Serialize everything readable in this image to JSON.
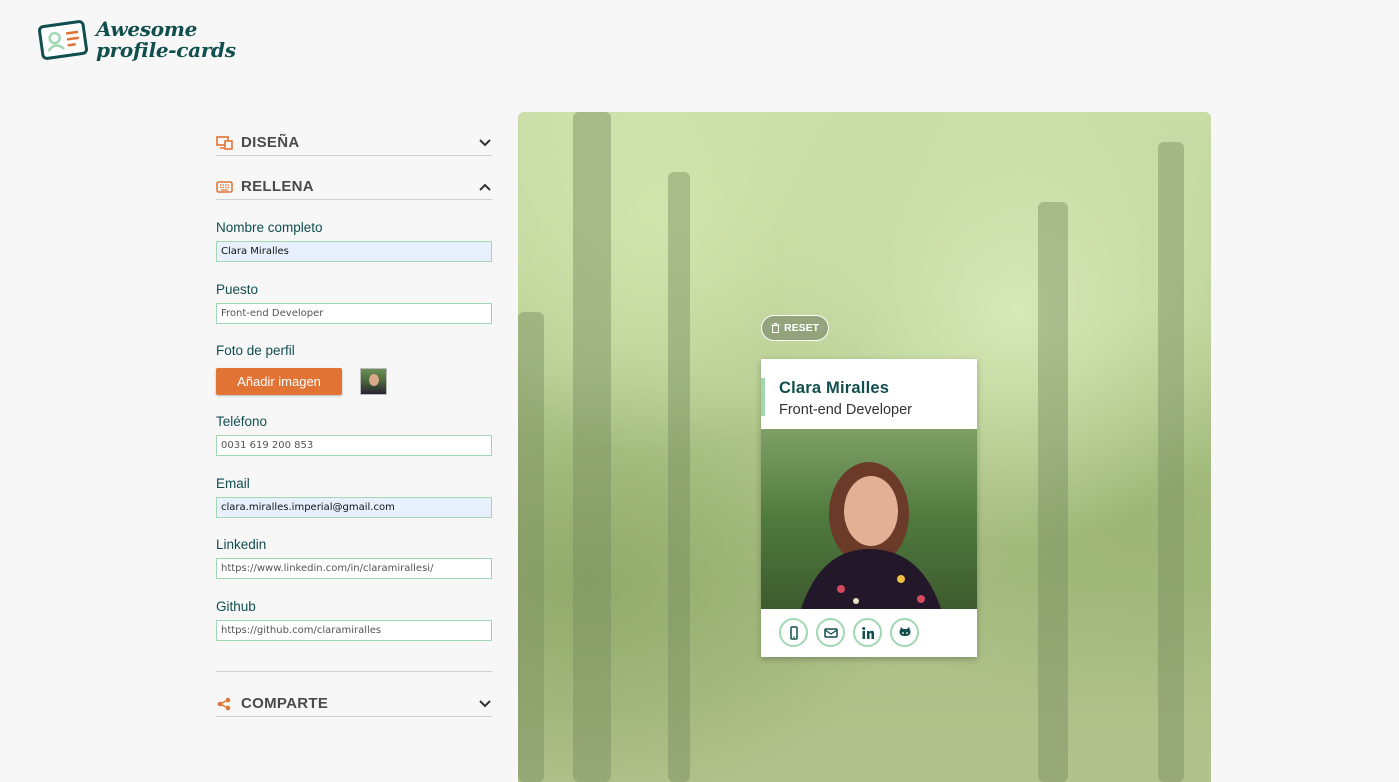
{
  "brand": {
    "line1": "Awesome",
    "line2": "profile-cards"
  },
  "sections": {
    "design": {
      "title": "DISEÑA"
    },
    "fill": {
      "title": "RELLENA"
    },
    "share": {
      "title": "COMPARTE"
    }
  },
  "form": {
    "name": {
      "label": "Nombre completo",
      "value": "Clara Miralles"
    },
    "job": {
      "label": "Puesto",
      "value": "Front-end Developer"
    },
    "photo": {
      "label": "Foto de perfil",
      "button": "Añadir imagen"
    },
    "phone": {
      "label": "Teléfono",
      "value": "0031 619 200 853"
    },
    "email": {
      "label": "Email",
      "value": "clara.miralles.imperial@gmail.com"
    },
    "linkedin": {
      "label": "Linkedin",
      "value": "https://www.linkedin.com/in/claramirallesi/"
    },
    "github": {
      "label": "Github",
      "value": "https://github.com/claramiralles"
    }
  },
  "preview": {
    "reset_label": "RESET",
    "card": {
      "name": "Clara Miralles",
      "job": "Front-end Developer",
      "icons": [
        "mobile-icon",
        "mail-icon",
        "linkedin-icon",
        "github-icon"
      ]
    }
  },
  "colors": {
    "brand": "#114e4e",
    "accent": "#e17334",
    "border": "#a1d8b4"
  }
}
